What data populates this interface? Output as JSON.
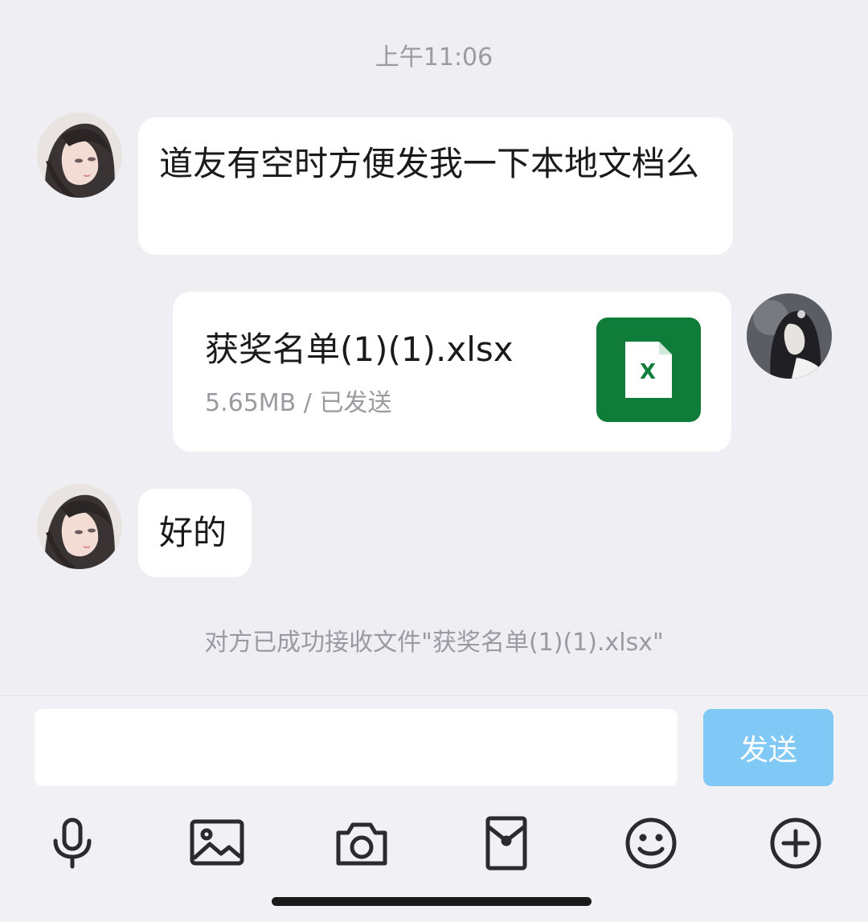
{
  "conversation": {
    "timestamp": "上午11:06",
    "messages": [
      {
        "sender": "other",
        "avatar": "contact-avatar",
        "text": "道友有空时方便发我一下本地文档么"
      },
      {
        "sender": "self",
        "avatar": "user-avatar",
        "type": "file",
        "file_name": "获奖名单(1)(1).xlsx",
        "file_meta": "5.65MB / 已发送",
        "file_icon": "excel-icon"
      },
      {
        "sender": "other",
        "avatar": "contact-avatar",
        "text": "好的"
      }
    ],
    "system_note": "对方已成功接收文件\"获奖名单(1)(1).xlsx\""
  },
  "composer": {
    "input_value": "",
    "send_label": "发送",
    "toolbar_icons": [
      "microphone-icon",
      "image-icon",
      "camera-icon",
      "red-packet-icon",
      "emoji-icon",
      "plus-icon"
    ]
  },
  "colors": {
    "background": "#eeeef3",
    "bubble": "#ffffff",
    "send_button": "#80c8f6",
    "excel_green": "#107c3a",
    "muted_text": "#9a9aa0"
  }
}
